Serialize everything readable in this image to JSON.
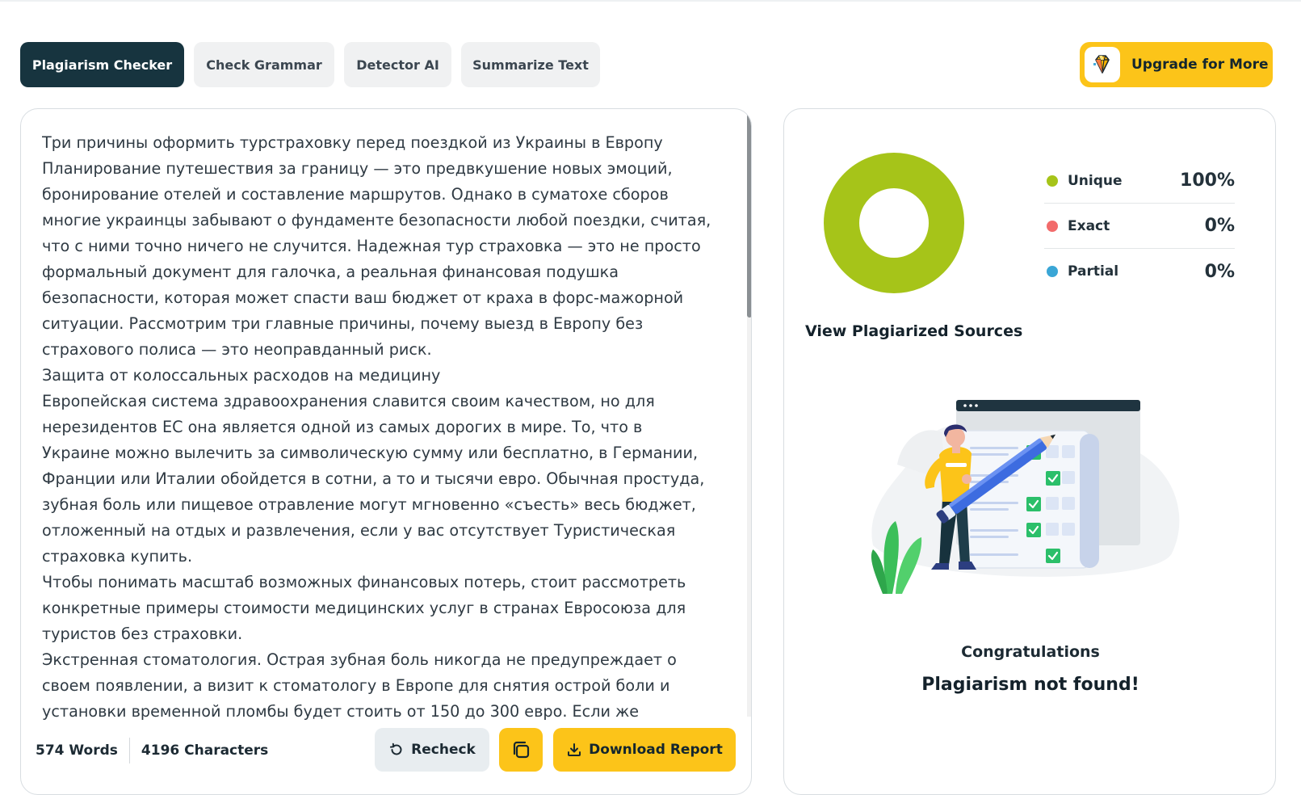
{
  "tabs": [
    {
      "label": "Plagiarism Checker",
      "active": true
    },
    {
      "label": "Check Grammar",
      "active": false
    },
    {
      "label": "Detector AI",
      "active": false
    },
    {
      "label": "Summarize Text",
      "active": false
    }
  ],
  "upgrade": {
    "label": "Upgrade for More",
    "icon": "diamond-icon"
  },
  "editor": {
    "text": "Три причины оформить турстраховку перед поездкой из Украины в Европу\nПланирование путешествия за границу — это предвкушение новых эмоций, бронирование отелей и составление маршрутов. Однако в суматохе сборов многие украинцы забывают о фундаменте безопасности любой поездки, считая, что с ними точно ничего не случится. Надежная тур страховка — это не просто формальный документ для галочка, а реальная финансовая подушка безопасности, которая может спасти ваш бюджет от краха в форс-мажорной ситуации. Рассмотрим три главные причины, почему выезд в Европу без страхового полиса — это неоправданный риск.\nЗащита от колоссальных расходов на медицину\nЕвропейская система здравоохранения славится своим качеством, но для нерезидентов ЕС она является одной из самых дорогих в мире. То, что в Украине можно вылечить за символическую сумму или бесплатно, в Германии, Франции или Италии обойдется в сотни, а то и тысячи евро. Обычная простуда, зубная боль или пищевое отравление могут мгновенно «съесть» весь бюджет, отложенный на отдых и развлечения, если у вас отсутствует Туристическая страховка купить.\nЧтобы понимать масштаб возможных финансовых потерь, стоит рассмотреть конкретные примеры стоимости медицинских услуг в странах Евросоюза для туристов без страховки.\nЭкстренная стоматология. Острая зубная боль никогда не предупреждает о своем появлении, а визит к стоматологу в Европе для снятия острой боли и установки временной пломбы будет стоить от 150 до 300 евро. Если же"
  },
  "stats": {
    "words": "574 Words",
    "characters": "4196 Characters"
  },
  "actions": {
    "recheck": "Recheck",
    "download": "Download Report"
  },
  "results": {
    "legend": [
      {
        "label": "Unique",
        "value": "100%",
        "color": "#a6c419"
      },
      {
        "label": "Exact",
        "value": "0%",
        "color": "#f26b6b"
      },
      {
        "label": "Partial",
        "value": "0%",
        "color": "#3aa6d6"
      }
    ],
    "unique_fraction": 1.0,
    "view_sources": "View Plagiarized Sources",
    "congrats": "Congratulations",
    "not_found": "Plagiarism not found!"
  }
}
